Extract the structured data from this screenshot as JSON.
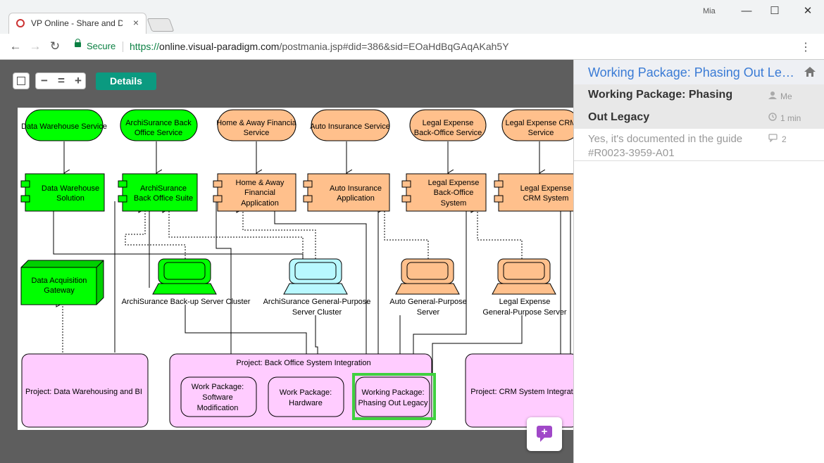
{
  "browser": {
    "tab_title": "VP Online - Share and Di",
    "tab_close": "×",
    "user_label": "Mia",
    "secure_label": "Secure",
    "url_scheme": "https://",
    "url_host": "online.visual-paradigm.com",
    "url_path": "/postmania.jsp#did=386&sid=EOaHdBqGAqAKah5Y",
    "back": "←",
    "forward": "→",
    "reload": "↻",
    "menu": "⋮",
    "minimize": "—",
    "maximize": "☐",
    "close": "✕"
  },
  "toolbar": {
    "zoom_out": "−",
    "zoom_reset": "=",
    "zoom_in": "+",
    "details_label": "Details"
  },
  "diagram": {
    "services": [
      "Data Warehouse Service",
      "ArchiSurance Back Office Service",
      "Home & Away Financial Service",
      "Auto Insurance Service",
      "Legal Expense Back-Office Service",
      "Legal Expense CRM Service"
    ],
    "components": [
      "Data Warehouse Solution",
      "ArchiSurance Back Office Suite",
      "Home & Away Financial Application",
      "Auto Insurance Application",
      "Legal Expense Back-Office System",
      "Legal Expense CRM System"
    ],
    "node": "Data Acquisition Gateway",
    "devices": [
      "ArchiSurance Back-up Server Cluster",
      "ArchiSurance General-Purpose Server Cluster",
      "Auto General-Purpose Server",
      "Legal Expense General-Purpose Server"
    ],
    "projects": [
      "Project: Data Warehousing and BI",
      "Project: Back Office System Integration",
      "Project: CRM System Integrat"
    ],
    "work_packages": [
      "Work Package: Software Modification",
      "Work Package: Hardware",
      "Working Package: Phasing Out Legacy"
    ],
    "colors": {
      "green": "#00ff00",
      "orange": "#ffc08c",
      "cyan": "#b8f8ff",
      "pink": "#ffccff",
      "highlight": "#40d040"
    }
  },
  "panel": {
    "title": "Working Package: Phasing Out Legacy",
    "item_title_1": "Working Package: Phasing",
    "item_title_2": "Out Legacy",
    "author": "Me",
    "time": "1 min",
    "comment": "Yes, it's documented in the guide #R0023-3959-A01",
    "reply_count": "2"
  }
}
